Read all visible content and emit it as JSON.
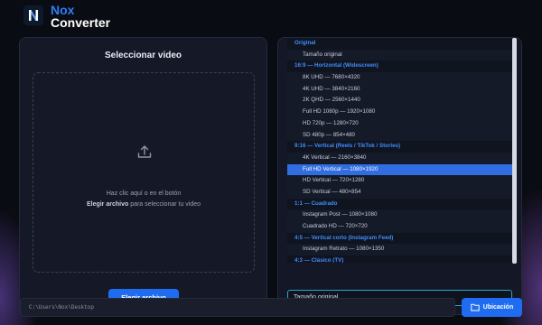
{
  "app": {
    "title_accent": "Nox",
    "title_rest": "Converter",
    "logo_letter": "N"
  },
  "left": {
    "title": "Seleccionar video",
    "drop_line1": "Haz clic aquí o en el botón",
    "drop_line2_bold": "Elegir archivo",
    "drop_line2_rest": " para seleccionar tu video",
    "button_label": "Elegir archivo"
  },
  "resolutions": {
    "items": [
      {
        "type": "header",
        "label": "Original"
      },
      {
        "type": "option",
        "label": "Tamaño original"
      },
      {
        "type": "header",
        "label": "16:9 — Horizontal (Widescreen)"
      },
      {
        "type": "option",
        "label": "8K UHD — 7680×4320"
      },
      {
        "type": "option",
        "label": "4K UHD — 3840×2160"
      },
      {
        "type": "option",
        "label": "2K QHD — 2560×1440"
      },
      {
        "type": "option",
        "label": "Full HD 1080p — 1920×1080"
      },
      {
        "type": "option",
        "label": "HD 720p — 1280×720"
      },
      {
        "type": "option",
        "label": "SD 480p — 854×480"
      },
      {
        "type": "header",
        "label": "9:16 — Vertical (Reels / TikTok / Stories)"
      },
      {
        "type": "option",
        "label": "4K Vertical — 2160×3840"
      },
      {
        "type": "option",
        "label": "Full HD Vertical — 1080×1920",
        "selected": true
      },
      {
        "type": "option",
        "label": "HD Vertical — 720×1280"
      },
      {
        "type": "option",
        "label": "SD Vertical — 480×854"
      },
      {
        "type": "header",
        "label": "1:1 — Cuadrado"
      },
      {
        "type": "option",
        "label": "Instagram Post — 1080×1080"
      },
      {
        "type": "option",
        "label": "Cuadrado HD — 720×720"
      },
      {
        "type": "header",
        "label": "4:5 — Vertical corto (Instagram Feed)"
      },
      {
        "type": "option",
        "label": "Instagram Retrato — 1080×1350"
      },
      {
        "type": "header",
        "label": "4:3 — Clásico (TV)"
      },
      {
        "type": "option",
        "label": "HD Clásico — 1440×1080"
      }
    ],
    "selected_value": "Tamaño original"
  },
  "footer": {
    "path": "C:\\Users\\Nox\\Desktop",
    "location_button": "Ubicación"
  },
  "colors": {
    "accent": "#1f6cf0",
    "header_text": "#3f8cff",
    "selected_row": "#2f6de0"
  }
}
